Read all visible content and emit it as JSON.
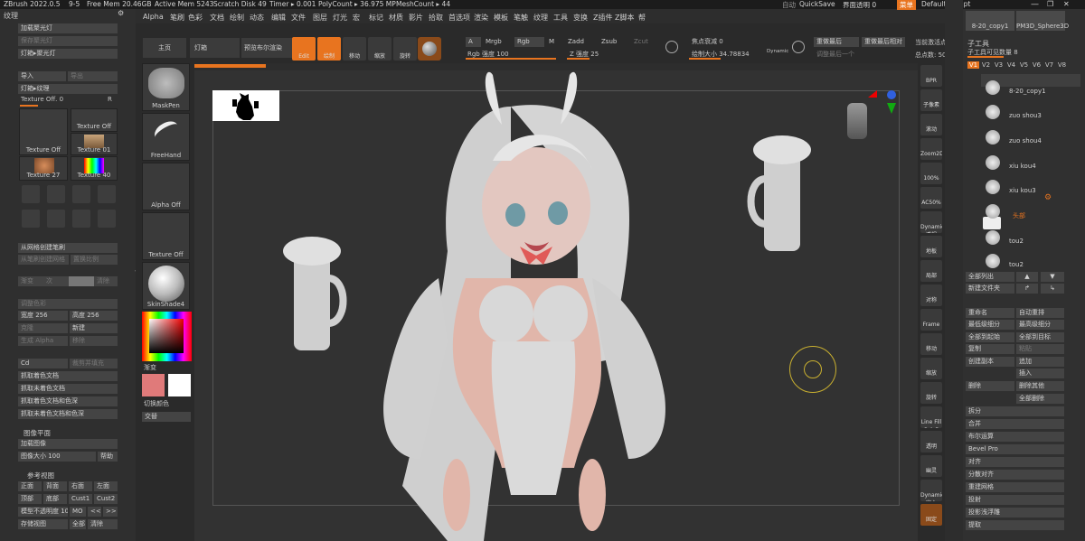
{
  "topbar": {
    "title": "ZBrush 2022.0.5",
    "pages": "9-5",
    "free_mem": "Free Mem 20.46GB",
    "active_mem": "Active Mem 5243",
    "scratch": "Scratch Disk 49",
    "timer": "Timer ▸ 0.001",
    "poly": "PolyCount ▸ 36.975 MP",
    "mesh": "MeshCount ▸ 44",
    "auto": "自动",
    "quicksave": "QuickSave",
    "ui_transparency": "界面透明 0",
    "menu": "菜单",
    "script": "DefaultZScript"
  },
  "menubar": [
    "Alpha",
    "笔刷",
    "色彩",
    "文档",
    "绘制",
    "动态",
    "编辑",
    "文件",
    "图层",
    "灯光",
    "宏",
    "标记",
    "材质",
    "影片",
    "拾取",
    "首选项",
    "渲染",
    "模板",
    "笔触",
    "纹理",
    "工具",
    "变换",
    "Z插件",
    "Z脚本",
    "帮助"
  ],
  "left": {
    "title": "纹理",
    "light_buttons": [
      "加载聚光灯",
      "保存聚光灯",
      "灯箱▸聚光灯"
    ],
    "import": "导入",
    "export": "导出",
    "lightbox_texture": "灯箱▸纹理",
    "texture_off": "Texture Off. 0",
    "r": "R",
    "texture_tiles": [
      "Texture Off",
      "Texture Off",
      "Texture 01",
      "Texture 27",
      "Texture 40"
    ],
    "small_icons": [
      "转纹理",
      "翻转",
      "On/Off",
      "选择",
      "名称",
      "名称",
      "翻转",
      "历史"
    ],
    "create_brush": "从网格创建笔刷",
    "create_from_alpha": "从笔刷创建网格",
    "shade": "置换比例",
    "grad": "渐变",
    "times": "次",
    "clear": "清除",
    "adjust": "调整色彩",
    "width": "宽度 256",
    "height": "高度 256",
    "clone": "克隆",
    "new": "新建",
    "make_alpha": "生成 Alpha",
    "remove": "移除",
    "cd": "Cd",
    "fill": "裁剪并填充",
    "grab_list": [
      "抓取着色文档",
      "抓取未着色文档",
      "抓取着色文档和色深",
      "抓取未着色文档和色深"
    ],
    "image_plane": "图像平面",
    "load_image": "加载图像",
    "image_size": "图像大小 100",
    "help": "帮助",
    "ref_views": "参考视图",
    "views": [
      "正面",
      "背面",
      "右面",
      "左面",
      "顶部",
      "底部",
      "Cust1",
      "Cust2"
    ],
    "model_opacity": "模型不透明度 10",
    "mo": "MO",
    "prev": "<<",
    "next": ">>",
    "store_view": "存储视图",
    "all": "全部",
    "clear2": "清除"
  },
  "shelf": {
    "home": "主页",
    "lightbox": "灯箱",
    "preview_bpr": "预览布尔渲染",
    "edit": "Edit",
    "draw": "绘制",
    "move": "移动",
    "scale": "缩放",
    "rotate": "旋转",
    "a": "A",
    "mrgb": "Mrgb",
    "rgb": "Rgb",
    "m": "M",
    "zadd": "Zadd",
    "zsub": "Zsub",
    "zcut": "Zcut",
    "rgb_intensity": "Rgb 强度 100",
    "z_intensity": "Z 强度 25",
    "focal": "焦点衰减 0",
    "draw_size": "绘制大小 34.78834",
    "dynamic": "Dynamic",
    "redo_last": "重做最后",
    "redo_last_rel": "重做最后相对",
    "adjust_last": "调整最后一个",
    "current_active": "当前激活点",
    "total_points": "总点数: 50"
  },
  "brushes": [
    "MaskPen",
    "FreeHand",
    "Alpha Off",
    "Texture Off",
    "SkinShade4"
  ],
  "color": {
    "gradient": "渐变",
    "switch": "切换颜色",
    "alternate": "交替",
    "main_color": "#e07a7a",
    "secondary": "#ffffff"
  },
  "right_icons": [
    "BPR",
    "子像素",
    "滚动",
    "Zoom2D",
    "100%",
    "AC50%",
    "Dynamic 透视",
    "地板",
    "局部",
    "对称",
    "Frame",
    "移动",
    "缩放",
    "旋转",
    "Line Fill PolyF",
    "透明",
    "幽灵",
    "Dynamic 实心",
    "固定"
  ],
  "subtool": {
    "title": "子工具",
    "count": "子工具可见数量 8",
    "versions": [
      "V1",
      "V2",
      "V3",
      "V4",
      "V5",
      "V6",
      "V7",
      "V8"
    ],
    "items": [
      "8-20_copy1",
      "zuo shou3",
      "zuo shou4",
      "xiu kou4",
      "xiu kou3",
      "头部",
      "tou2",
      "tou2"
    ],
    "top_thumbs": [
      "8-20_copy1",
      "PM3D_Sphere3D"
    ],
    "list_all": "全部列出",
    "new_folder": "新建文件夹",
    "actions": [
      [
        "重命名",
        "自动重排"
      ],
      [
        "最低级细分",
        "最高级细分"
      ],
      [
        "全部到起始",
        "全部到目标"
      ],
      [
        "复制",
        "粘贴"
      ],
      [
        "创建副本",
        "追加"
      ],
      [
        "",
        "插入"
      ],
      [
        "删除",
        "删除其他"
      ],
      [
        "",
        "全部删除"
      ]
    ],
    "more": [
      "拆分",
      "合并",
      "布尔运算",
      "Bevel Pro",
      "对齐",
      "分散对齐",
      "重建网格",
      "投射",
      "投影浅浮雕",
      "提取"
    ]
  }
}
